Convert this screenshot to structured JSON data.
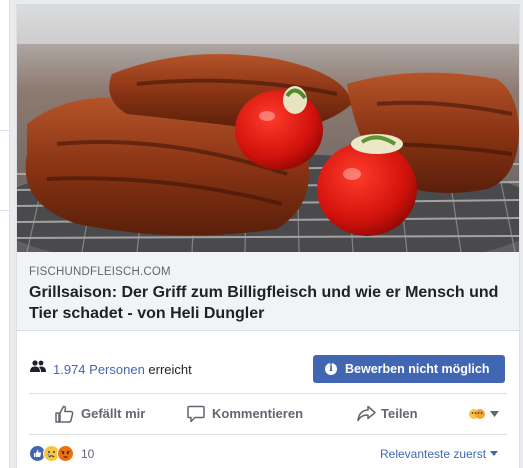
{
  "post": {
    "domain": "FISCHUNDFLEISCH.COM",
    "headline": "Grillsaison: Der Griff zum Billigfleisch und wie er Mensch und Tier schadet - von Heli Dungler"
  },
  "reach": {
    "count": "1.974 Personen",
    "suffix": "erreicht",
    "boost_label": "Bewerben nicht möglich"
  },
  "actions": {
    "like": "Gefällt mir",
    "comment": "Kommentieren",
    "share": "Teilen"
  },
  "footer": {
    "reaction_count": "10",
    "sort_label": "Relevanteste zuerst"
  },
  "colors": {
    "accent": "#4267b2",
    "text_secondary": "#606770"
  }
}
